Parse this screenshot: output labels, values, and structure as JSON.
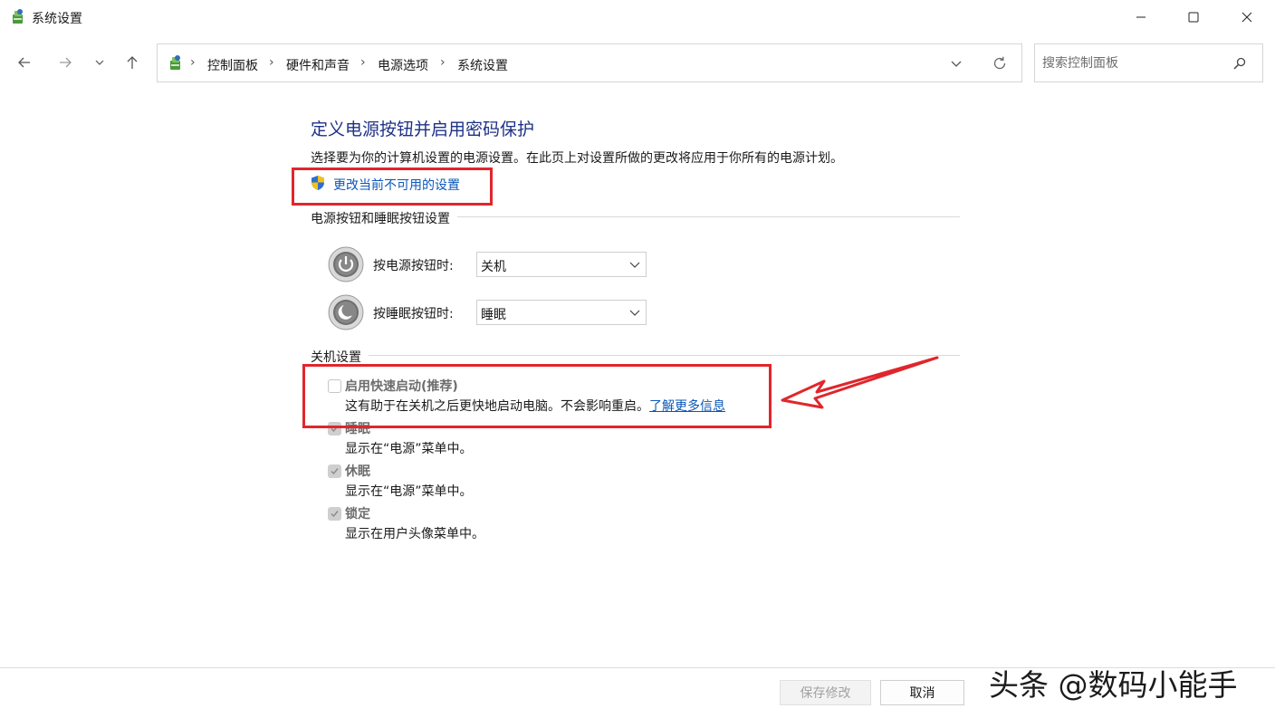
{
  "window": {
    "title": "系统设置",
    "app_icon": "control-panel-icon",
    "buttons": [
      "minimize-icon",
      "maximize-icon",
      "close-icon"
    ]
  },
  "nav": {
    "back_icon": "arrow-left-icon",
    "forward_icon": "arrow-right-icon",
    "recent_icon": "chevron-down-icon",
    "up_icon": "arrow-up-icon",
    "breadcrumbs": [
      "控制面板",
      "硬件和声音",
      "电源选项",
      "系统设置"
    ],
    "separator": "›",
    "refresh_icon": "refresh-icon",
    "search": {
      "placeholder": "搜索控制面板",
      "value": "",
      "icon": "search-icon"
    }
  },
  "main": {
    "title": "定义电源按钮并启用密码保护",
    "description": "选择要为你的计算机设置的电源设置。在此页上对设置所做的更改将应用于你所有的电源计划。",
    "change_link": "更改当前不可用的设置",
    "power_section": {
      "heading": "电源按钮和睡眠按钮设置",
      "rows": [
        {
          "label": "按电源按钮时:",
          "value": "关机",
          "icon": "power-button-icon"
        },
        {
          "label": "按睡眠按钮时:",
          "value": "睡眠",
          "icon": "sleep-button-icon"
        }
      ]
    },
    "shutdown_section": {
      "heading": "关机设置",
      "items": [
        {
          "label": "启用快速启动(推荐)",
          "desc": "这有助于在关机之后更快地启动电脑。不会影响重启。",
          "link": "了解更多信息",
          "checked": false
        },
        {
          "label": "睡眠",
          "desc": "显示在“电源”菜单中。",
          "checked": true
        },
        {
          "label": "休眠",
          "desc": "显示在“电源”菜单中。",
          "checked": true
        },
        {
          "label": "锁定",
          "desc": "显示在用户头像菜单中。",
          "checked": true
        }
      ]
    }
  },
  "footer": {
    "save_label": "保存修改",
    "cancel_label": "取消"
  },
  "watermark": "头条 @数码小能手",
  "colors": {
    "accent_title": "#1e3287",
    "link": "#0b57b8",
    "annotation": "#e0262c"
  }
}
